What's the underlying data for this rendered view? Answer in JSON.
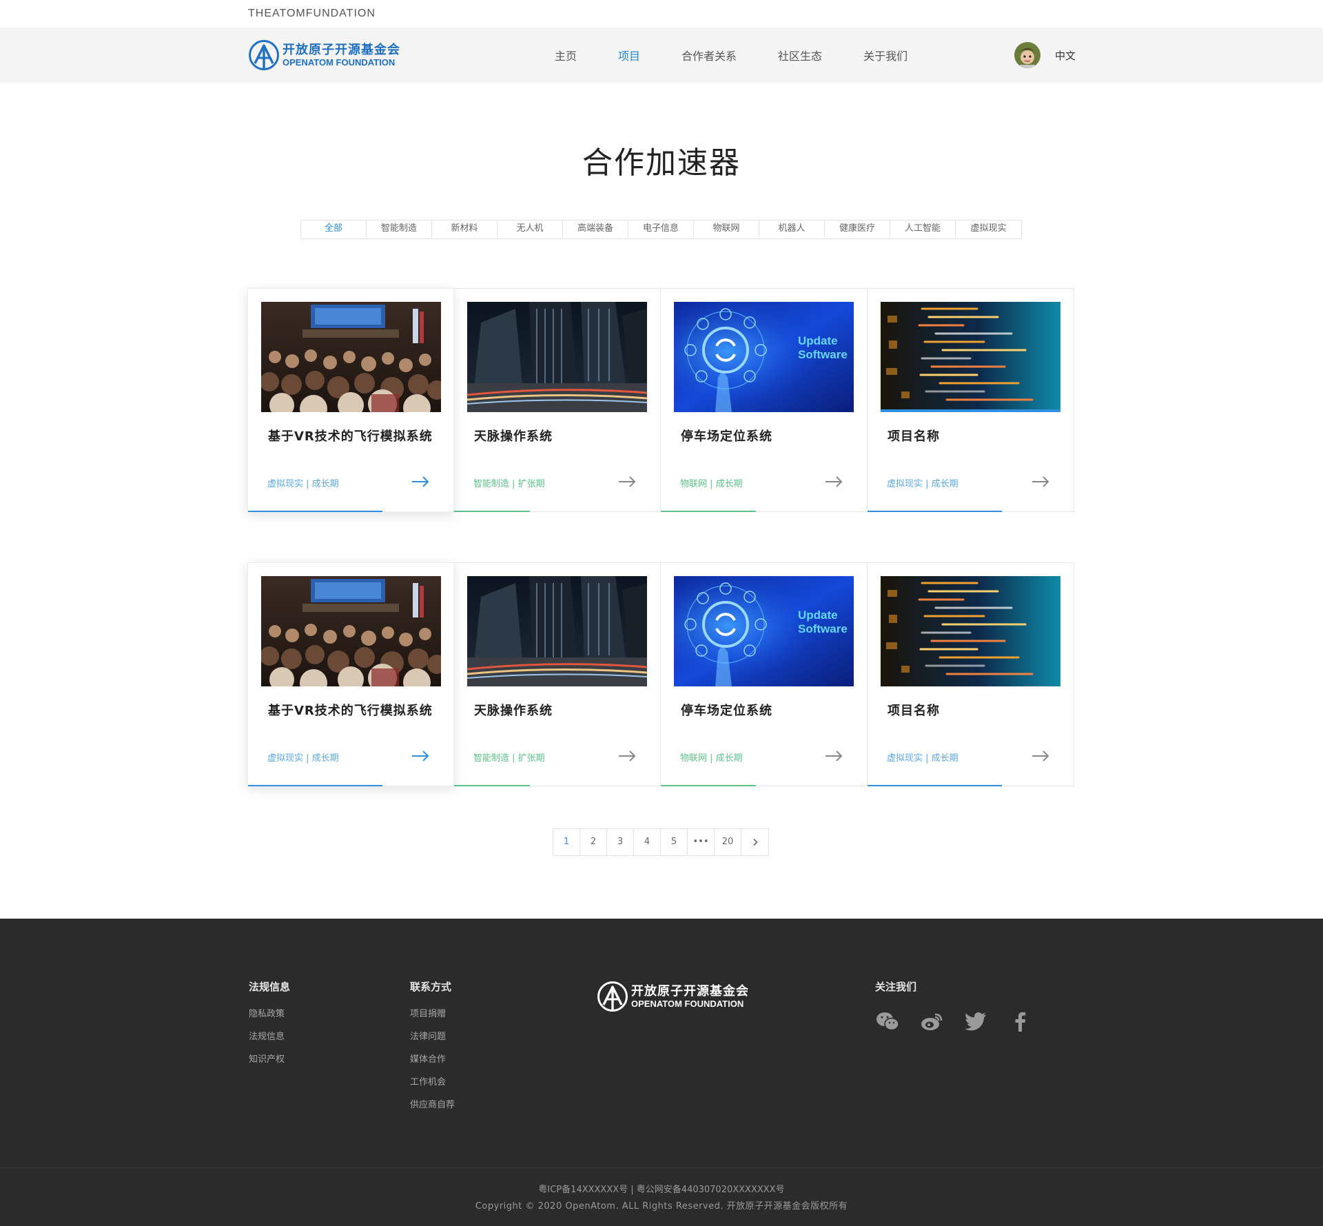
{
  "top": {
    "brand_text": "THEATOMFUNDATION"
  },
  "logo": {
    "cn": "开放原子开源基金会",
    "en": "OPENATOM FOUNDATION",
    "color": "#1f6fc5"
  },
  "nav": {
    "items": [
      {
        "label": "主页"
      },
      {
        "label": "项目"
      },
      {
        "label": "合作者关系"
      },
      {
        "label": "社区生态"
      },
      {
        "label": "关于我们"
      }
    ],
    "active_index": 1,
    "language": "中文"
  },
  "page": {
    "title": "合作加速器"
  },
  "filters": {
    "items": [
      "全部",
      "智能制造",
      "新材料",
      "无人机",
      "高端装备",
      "电子信息",
      "物联网",
      "机器人",
      "健康医疗",
      "人工智能",
      "虚拟现实"
    ],
    "active_index": 0
  },
  "cards_row1": [
    {
      "title": "基于VR技术的飞行模拟系统",
      "tag": "虚拟现实",
      "stage": "成长期",
      "meta": "虚拟现实 | 成长期",
      "image": "conference-audience-photo",
      "accent": "blue",
      "raised": true,
      "bar_fraction": 0.65
    },
    {
      "title": "天脉操作系统",
      "tag": "智能制造",
      "stage": "扩张期",
      "meta": "智能制造 | 扩张期",
      "image": "night-city-skyscraper-photo",
      "accent": "green",
      "raised": false,
      "bar_fraction": 0.37
    },
    {
      "title": "停车场定位系统",
      "tag": "物联网",
      "stage": "成长期",
      "meta": "物联网 | 成长期",
      "image": "update-software-hand-graphic",
      "image_text": [
        "Update",
        "Software"
      ],
      "accent": "green",
      "raised": false,
      "bar_fraction": 0.46
    },
    {
      "title": "项目名称",
      "tag": "虚拟现实",
      "stage": "成长期",
      "meta": "虚拟现实 | 成长期",
      "image": "code-screen-photo",
      "accent": "blue",
      "raised": false,
      "bar_fraction": 0.65
    }
  ],
  "cards_row2": [
    {
      "title": "基于VR技术的飞行模拟系统",
      "meta": "虚拟现实 | 成长期",
      "image": "conference-audience-photo",
      "accent": "blue",
      "raised": true,
      "bar_fraction": 0.65
    },
    {
      "title": "天脉操作系统",
      "meta": "智能制造 | 扩张期",
      "image": "night-city-skyscraper-photo",
      "accent": "green",
      "raised": false,
      "bar_fraction": 0.37
    },
    {
      "title": "停车场定位系统",
      "meta": "物联网 | 成长期",
      "image": "update-software-hand-graphic",
      "image_text": [
        "Update",
        "Software"
      ],
      "accent": "green",
      "raised": false,
      "bar_fraction": 0.46
    },
    {
      "title": "项目名称",
      "meta": "虚拟现实 | 成长期",
      "image": "code-screen-photo",
      "accent": "blue",
      "raised": false,
      "bar_fraction": 0.65
    }
  ],
  "pagination": {
    "pages": [
      "1",
      "2",
      "3",
      "4",
      "5",
      "•••",
      "20"
    ],
    "active": "1",
    "next_icon": "chevron-right-icon"
  },
  "footer": {
    "legal": {
      "heading": "法规信息",
      "links": [
        "隐私政策",
        "法规信息",
        "知识产权"
      ]
    },
    "contact": {
      "heading": "联系方式",
      "links": [
        "项目捐赠",
        "法律问题",
        "媒体合作",
        "工作机会",
        "供应商自荐"
      ]
    },
    "follow": {
      "heading": "关注我们",
      "icons": [
        "wechat-icon",
        "weibo-icon",
        "twitter-icon",
        "facebook-icon"
      ]
    },
    "icp": "粤ICP备14XXXXXX号   |   粤公网安备440307020XXXXXXX号",
    "copyright": "Copyright  ©  2020 OpenAtom. ALL Rights Reserved. 开放原子开源基金会版权所有"
  },
  "colors": {
    "accent_blue": "#2f8fe0",
    "accent_green": "#5dc38a",
    "footer_bg": "#2b2b2b",
    "navbar_bg": "#f4f4f4"
  }
}
